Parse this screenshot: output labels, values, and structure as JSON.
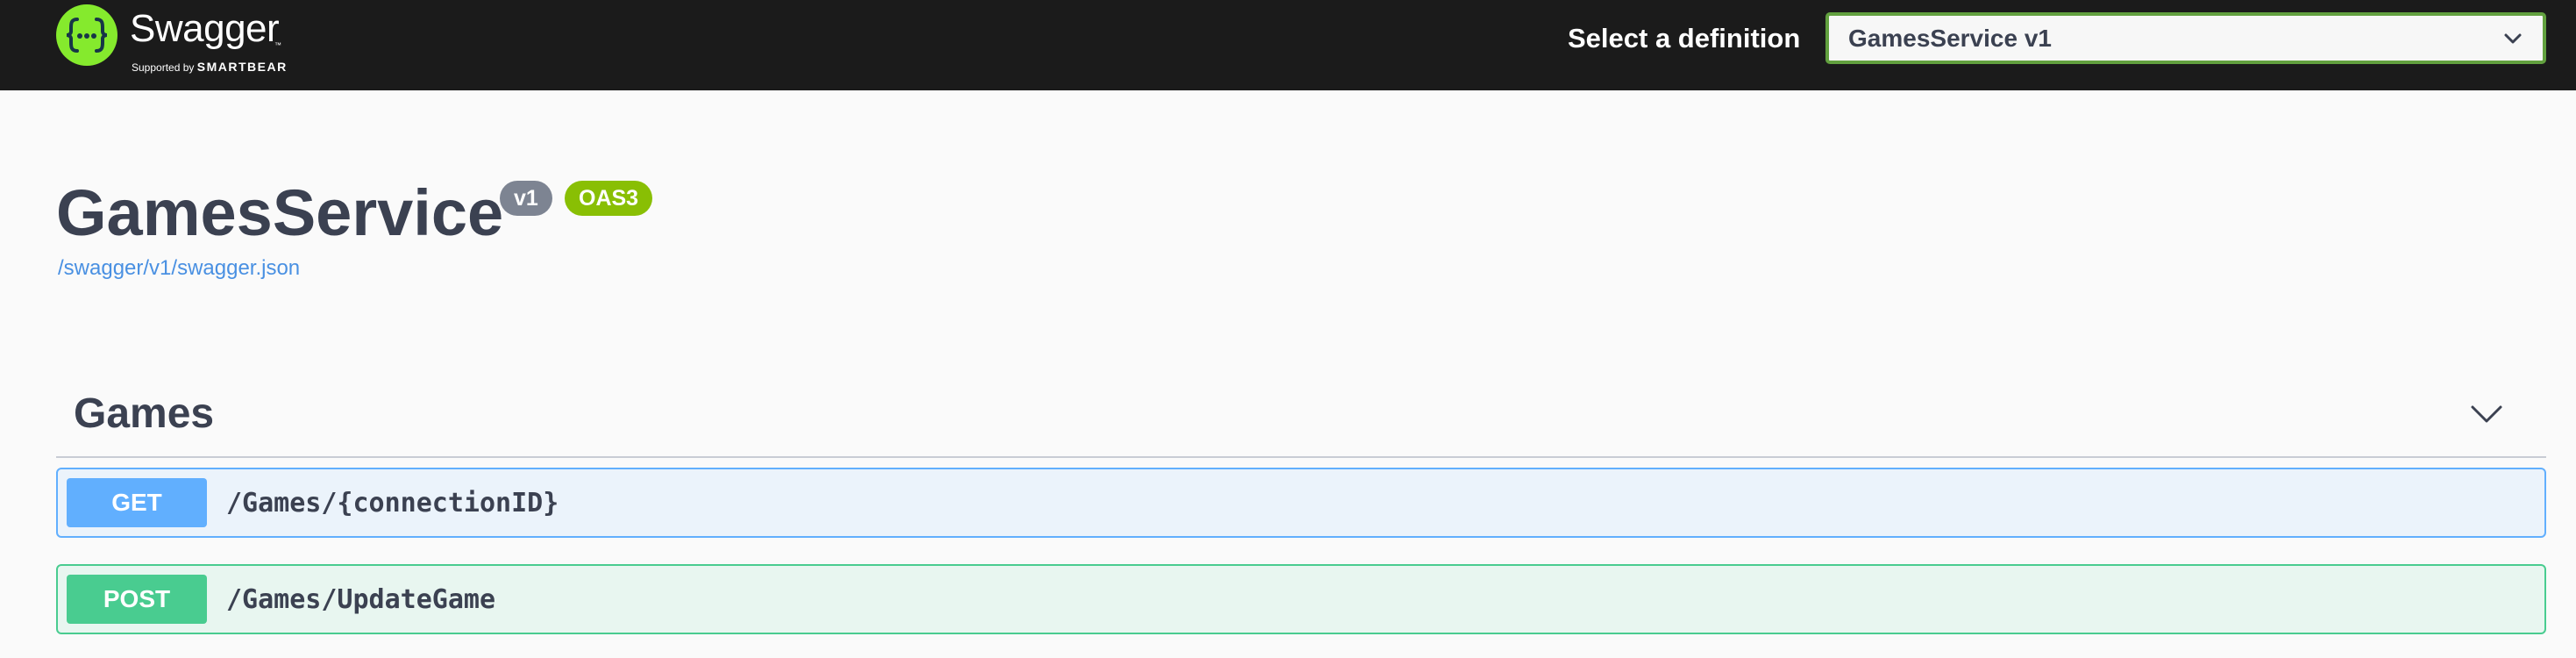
{
  "topbar": {
    "logo_word": "Swagger",
    "logo_tm": "™",
    "logo_supported_prefix": "Supported by",
    "logo_supported_brand": "SMARTBEAR",
    "definition_label": "Select a definition",
    "definition_selected": "GamesService v1",
    "accent_color": "#85ea2d"
  },
  "info": {
    "title": "GamesService",
    "version_badge": "v1",
    "spec_badge": "OAS3",
    "spec_url": "/swagger/v1/swagger.json"
  },
  "tags": [
    {
      "name": "Games",
      "operations": [
        {
          "method": "GET",
          "path": "/Games/{connectionID}",
          "color": "#61affe"
        },
        {
          "method": "POST",
          "path": "/Games/UpdateGame",
          "color": "#49cc90"
        }
      ]
    }
  ],
  "icons": {
    "logo": "swagger-braces-icon",
    "select_arrow": "chevron-down-icon",
    "tag_toggle": "chevron-down-icon"
  }
}
